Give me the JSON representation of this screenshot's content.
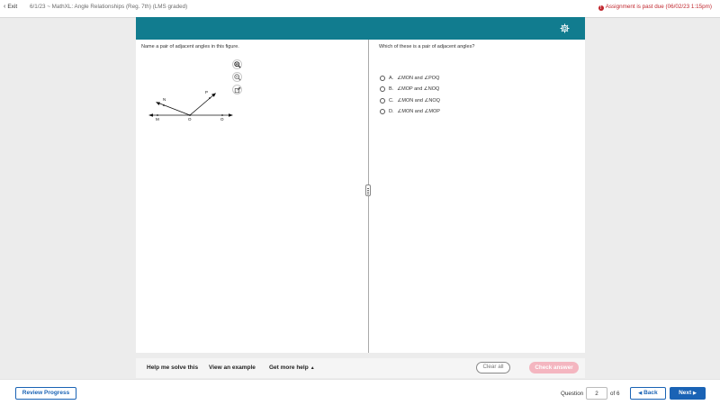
{
  "topbar": {
    "exit_label": "Exit",
    "course_title": "6/1/23 ~ MathXL: Angle Relationships (Reg. 7th) (LMS graded)",
    "past_due": "Assignment is past due (06/02/23 1:15pm)"
  },
  "question": {
    "prompt": "Name a pair of adjacent angles in this figure.",
    "sub_prompt": "Which of these is a pair of adjacent angles?",
    "figure_labels": {
      "M": "M",
      "O": "O",
      "Q": "Q",
      "N": "N",
      "P": "P"
    },
    "choices": [
      {
        "letter": "A.",
        "text": "∠MON and ∠POQ"
      },
      {
        "letter": "B.",
        "text": "∠MOP and ∠NOQ"
      },
      {
        "letter": "C.",
        "text": "∠MON and ∠NOQ"
      },
      {
        "letter": "D.",
        "text": "∠MON and ∠MOP"
      }
    ]
  },
  "helpbar": {
    "solve": "Help me solve this",
    "example": "View an example",
    "more": "Get more help",
    "clear": "Clear all",
    "check": "Check answer"
  },
  "footer": {
    "review": "Review Progress",
    "question_label": "Question",
    "question_value": "2",
    "of_label": "of 6",
    "back": "Back",
    "next": "Next"
  },
  "colors": {
    "header_teal": "#117c8f",
    "primary_blue": "#1a63b5",
    "past_due_red": "#c0262d",
    "check_pink": "#f4b6c0"
  },
  "icons": [
    "chevron-left-icon",
    "warning-icon",
    "gear-icon",
    "zoom-in-icon",
    "zoom-out-icon",
    "popout-icon",
    "chevron-right-icon"
  ]
}
